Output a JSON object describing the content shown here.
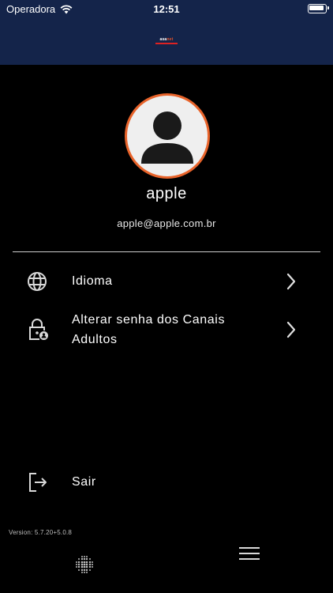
{
  "status_bar": {
    "carrier": "Operadora",
    "time": "12:51"
  },
  "header": {
    "logo_part1": "asa",
    "logo_part2": "net",
    "logo_icon": "asanet-logo"
  },
  "profile": {
    "username": "apple",
    "email": "apple@apple.com.br",
    "avatar_icon": "user-avatar-icon"
  },
  "menu": {
    "language_label": "Idioma",
    "language_icon": "globe-icon",
    "adult_password_line1": "Alterar senha dos Canais",
    "adult_password_line2": "Adultos",
    "adult_password_icon": "lock-person-icon",
    "logout_label": "Sair",
    "logout_icon": "logout-icon"
  },
  "footer": {
    "version": "Version: 5.7.20+5.0.8",
    "left_icon": "dots-grid-icon",
    "right_icon": "hamburger-menu-icon"
  },
  "colors": {
    "header_bg": "#14244a",
    "avatar_border": "#e8632a",
    "background": "#000000"
  }
}
